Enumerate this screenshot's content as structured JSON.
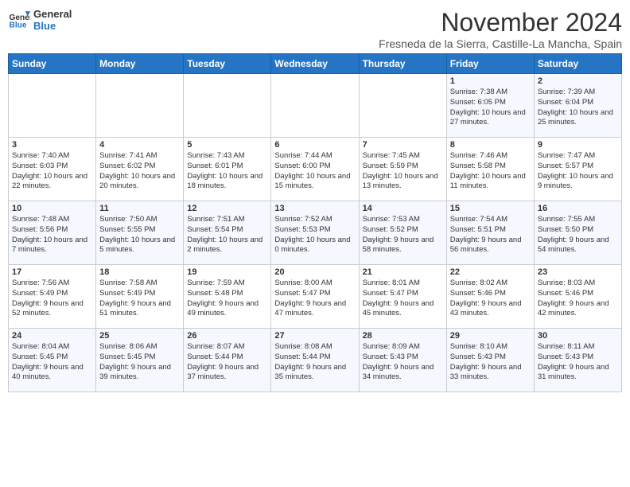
{
  "logo": {
    "line1": "General",
    "line2": "Blue"
  },
  "title": "November 2024",
  "subtitle": "Fresneda de la Sierra, Castille-La Mancha, Spain",
  "weekdays": [
    "Sunday",
    "Monday",
    "Tuesday",
    "Wednesday",
    "Thursday",
    "Friday",
    "Saturday"
  ],
  "weeks": [
    [
      {
        "day": "",
        "info": ""
      },
      {
        "day": "",
        "info": ""
      },
      {
        "day": "",
        "info": ""
      },
      {
        "day": "",
        "info": ""
      },
      {
        "day": "",
        "info": ""
      },
      {
        "day": "1",
        "info": "Sunrise: 7:38 AM\nSunset: 6:05 PM\nDaylight: 10 hours and 27 minutes."
      },
      {
        "day": "2",
        "info": "Sunrise: 7:39 AM\nSunset: 6:04 PM\nDaylight: 10 hours and 25 minutes."
      }
    ],
    [
      {
        "day": "3",
        "info": "Sunrise: 7:40 AM\nSunset: 6:03 PM\nDaylight: 10 hours and 22 minutes."
      },
      {
        "day": "4",
        "info": "Sunrise: 7:41 AM\nSunset: 6:02 PM\nDaylight: 10 hours and 20 minutes."
      },
      {
        "day": "5",
        "info": "Sunrise: 7:43 AM\nSunset: 6:01 PM\nDaylight: 10 hours and 18 minutes."
      },
      {
        "day": "6",
        "info": "Sunrise: 7:44 AM\nSunset: 6:00 PM\nDaylight: 10 hours and 15 minutes."
      },
      {
        "day": "7",
        "info": "Sunrise: 7:45 AM\nSunset: 5:59 PM\nDaylight: 10 hours and 13 minutes."
      },
      {
        "day": "8",
        "info": "Sunrise: 7:46 AM\nSunset: 5:58 PM\nDaylight: 10 hours and 11 minutes."
      },
      {
        "day": "9",
        "info": "Sunrise: 7:47 AM\nSunset: 5:57 PM\nDaylight: 10 hours and 9 minutes."
      }
    ],
    [
      {
        "day": "10",
        "info": "Sunrise: 7:48 AM\nSunset: 5:56 PM\nDaylight: 10 hours and 7 minutes."
      },
      {
        "day": "11",
        "info": "Sunrise: 7:50 AM\nSunset: 5:55 PM\nDaylight: 10 hours and 5 minutes."
      },
      {
        "day": "12",
        "info": "Sunrise: 7:51 AM\nSunset: 5:54 PM\nDaylight: 10 hours and 2 minutes."
      },
      {
        "day": "13",
        "info": "Sunrise: 7:52 AM\nSunset: 5:53 PM\nDaylight: 10 hours and 0 minutes."
      },
      {
        "day": "14",
        "info": "Sunrise: 7:53 AM\nSunset: 5:52 PM\nDaylight: 9 hours and 58 minutes."
      },
      {
        "day": "15",
        "info": "Sunrise: 7:54 AM\nSunset: 5:51 PM\nDaylight: 9 hours and 56 minutes."
      },
      {
        "day": "16",
        "info": "Sunrise: 7:55 AM\nSunset: 5:50 PM\nDaylight: 9 hours and 54 minutes."
      }
    ],
    [
      {
        "day": "17",
        "info": "Sunrise: 7:56 AM\nSunset: 5:49 PM\nDaylight: 9 hours and 52 minutes."
      },
      {
        "day": "18",
        "info": "Sunrise: 7:58 AM\nSunset: 5:49 PM\nDaylight: 9 hours and 51 minutes."
      },
      {
        "day": "19",
        "info": "Sunrise: 7:59 AM\nSunset: 5:48 PM\nDaylight: 9 hours and 49 minutes."
      },
      {
        "day": "20",
        "info": "Sunrise: 8:00 AM\nSunset: 5:47 PM\nDaylight: 9 hours and 47 minutes."
      },
      {
        "day": "21",
        "info": "Sunrise: 8:01 AM\nSunset: 5:47 PM\nDaylight: 9 hours and 45 minutes."
      },
      {
        "day": "22",
        "info": "Sunrise: 8:02 AM\nSunset: 5:46 PM\nDaylight: 9 hours and 43 minutes."
      },
      {
        "day": "23",
        "info": "Sunrise: 8:03 AM\nSunset: 5:46 PM\nDaylight: 9 hours and 42 minutes."
      }
    ],
    [
      {
        "day": "24",
        "info": "Sunrise: 8:04 AM\nSunset: 5:45 PM\nDaylight: 9 hours and 40 minutes."
      },
      {
        "day": "25",
        "info": "Sunrise: 8:06 AM\nSunset: 5:45 PM\nDaylight: 9 hours and 39 minutes."
      },
      {
        "day": "26",
        "info": "Sunrise: 8:07 AM\nSunset: 5:44 PM\nDaylight: 9 hours and 37 minutes."
      },
      {
        "day": "27",
        "info": "Sunrise: 8:08 AM\nSunset: 5:44 PM\nDaylight: 9 hours and 35 minutes."
      },
      {
        "day": "28",
        "info": "Sunrise: 8:09 AM\nSunset: 5:43 PM\nDaylight: 9 hours and 34 minutes."
      },
      {
        "day": "29",
        "info": "Sunrise: 8:10 AM\nSunset: 5:43 PM\nDaylight: 9 hours and 33 minutes."
      },
      {
        "day": "30",
        "info": "Sunrise: 8:11 AM\nSunset: 5:43 PM\nDaylight: 9 hours and 31 minutes."
      }
    ]
  ]
}
